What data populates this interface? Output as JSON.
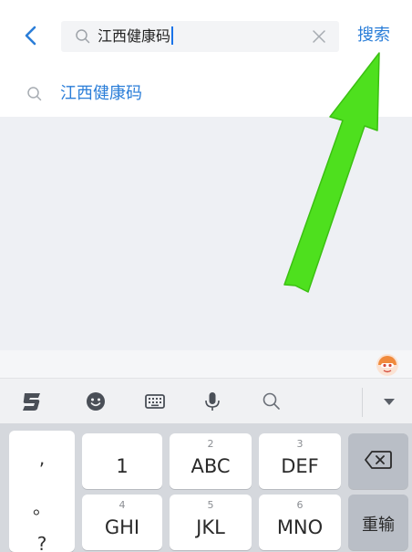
{
  "header": {
    "search_text": "江西健康码",
    "search_button": "搜索"
  },
  "suggestions": [
    {
      "text": "江西健康码"
    }
  ],
  "keyboard": {
    "side_keys": [
      ",",
      "。",
      "?"
    ],
    "keys": [
      {
        "sub": "",
        "main": "1"
      },
      {
        "sub": "2",
        "main": "ABC"
      },
      {
        "sub": "3",
        "main": "DEF"
      },
      {
        "sub": "4",
        "main": "GHI"
      },
      {
        "sub": "5",
        "main": "JKL"
      },
      {
        "sub": "6",
        "main": "MNO"
      }
    ],
    "reinput_label": "重输"
  },
  "colors": {
    "accent": "#2b7ed8",
    "arrow": "#4ee01e",
    "background": "#eef0f4"
  },
  "icons": {
    "back": "chevron-left-icon",
    "search": "search-icon",
    "clear": "close-icon",
    "sogou": "sogou-logo-icon",
    "emoji": "emoji-icon",
    "keyboard": "keyboard-icon",
    "mic": "microphone-icon",
    "collapse": "triangle-down-icon",
    "backspace": "backspace-icon"
  }
}
